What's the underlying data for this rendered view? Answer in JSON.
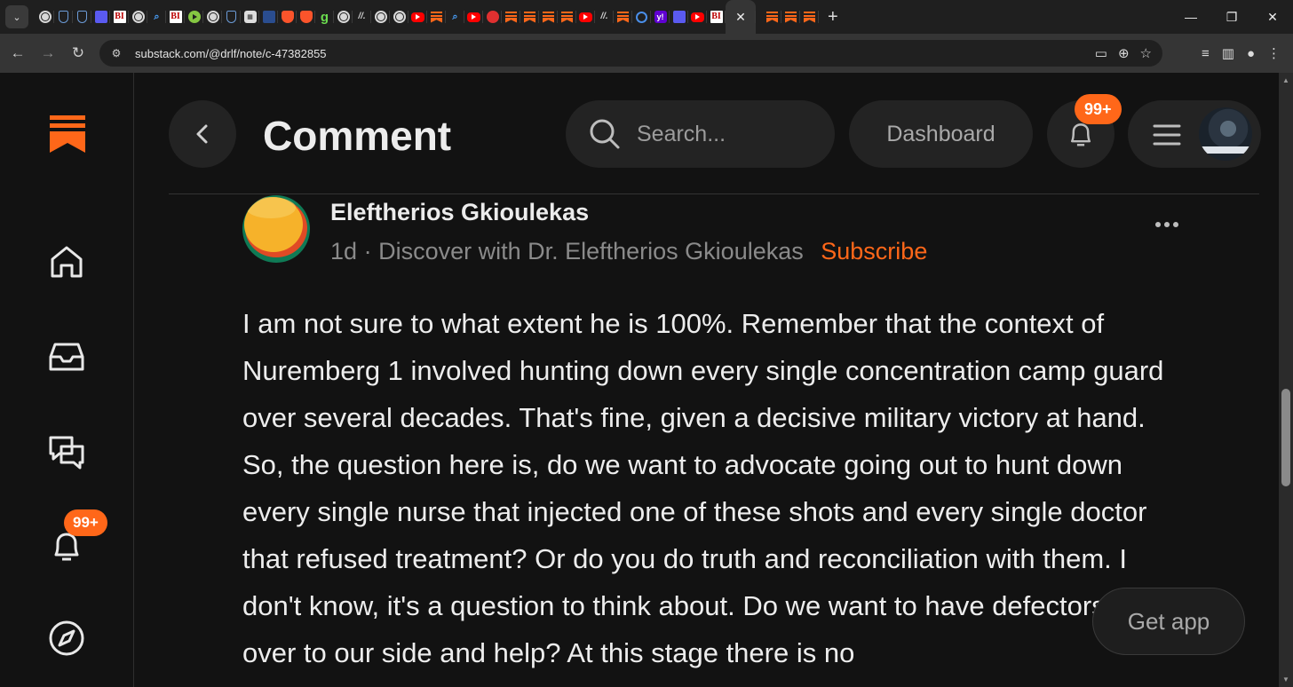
{
  "browser": {
    "url": "substack.com/@drlf/note/c-47382855",
    "tab_favicons": [
      "globe-icon",
      "shield-icon",
      "shield-icon",
      "video-icon",
      "bi-icon",
      "globe-icon",
      "search-icon",
      "bi-icon",
      "rumble-icon",
      "globe-icon",
      "shield-icon",
      "sheet-icon",
      "dark-icon",
      "brave-icon",
      "brave-icon",
      "g-icon",
      "globe-icon",
      "slash-icon",
      "globe-icon",
      "globe-icon",
      "youtube-icon",
      "substack-icon",
      "search-icon",
      "youtube-icon",
      "mic-icon",
      "substack-icon",
      "substack-icon",
      "substack-icon",
      "substack-icon",
      "youtube-icon",
      "slash-icon",
      "substack-icon",
      "c-icon",
      "yahoo-icon",
      "video-icon",
      "youtube-icon",
      "bi-icon",
      "substack-icon",
      "substack-icon",
      "substack-icon",
      "substack-icon",
      "substack-icon",
      "substack-icon",
      "substack-icon"
    ],
    "bi_label": "BI",
    "yahoo_label": "y!",
    "g_label": "g",
    "slash_label": "//.",
    "sheet_label": "▦",
    "search_glyph": "⌕"
  },
  "header": {
    "title": "Comment",
    "search_placeholder": "Search...",
    "dashboard_label": "Dashboard",
    "notification_badge": "99+"
  },
  "sidebar": {
    "notification_badge": "99+"
  },
  "post": {
    "author": "Eleftherios Gkioulekas",
    "age": "1d",
    "separator": "·",
    "publication": "Discover with Dr. Eleftherios Gkioulekas",
    "subscribe_label": "Subscribe",
    "body": "I am not sure to what extent he is 100%. Remember that the context of Nuremberg 1 involved hunting down every single concentration camp guard over several decades. That's fine, given a decisive military victory at hand. So, the question here is, do we want to advocate going out to hunt down every single nurse that injected one of these shots and every single doctor that refused treatment? Or do you do truth and reconciliation with them. I don't know, it's a question to think about. Do we want to have defectors come over to our side and help? At this stage there is no"
  },
  "get_app_label": "Get app",
  "colors": {
    "accent": "#ff6719",
    "background": "#121212",
    "surface": "#232323"
  }
}
